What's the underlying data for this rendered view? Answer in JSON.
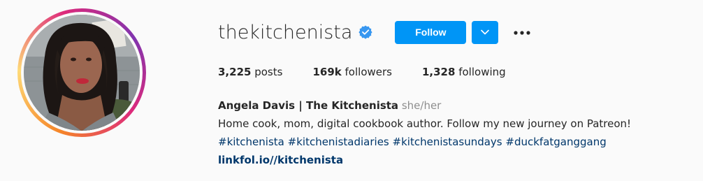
{
  "profile": {
    "username": "thekitchenista",
    "verified": true,
    "verified_icon": "verified-badge-icon",
    "follow_label": "Follow",
    "dropdown_icon": "chevron-down-icon",
    "more_icon": "more-options-icon",
    "accent_color": "#0095f6"
  },
  "stats": {
    "posts_count": "3,225",
    "posts_label": "posts",
    "followers_count": "169k",
    "followers_label": "followers",
    "following_count": "1,328",
    "following_label": "following"
  },
  "bio": {
    "display_name": "Angela Davis | The Kitchenista",
    "pronouns": "she/her",
    "description": "Home cook, mom, digital cookbook author. Follow my new journey on Patreon!",
    "hashtags": [
      "#kitchenista",
      "#kitchenistadiaries",
      "#kitchenistasundays",
      "#duckfatganggang"
    ],
    "link": "linkfol.io//kitchenista"
  }
}
